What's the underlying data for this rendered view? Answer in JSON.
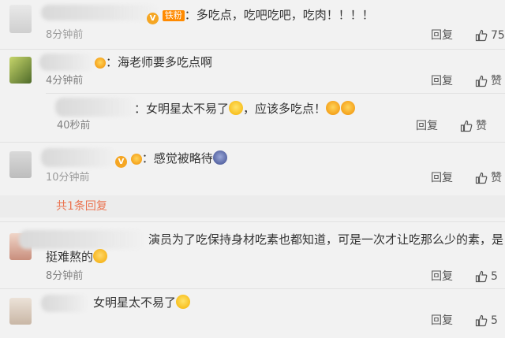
{
  "comments": [
    {
      "text": "：多吃点，吃吧吃吧，吃肉！！！！",
      "badge": "铁粉",
      "time": "8分钟前",
      "reply_label": "回复",
      "likes": "75"
    },
    {
      "text": "：海老师要多吃点啊",
      "time": "4分钟前",
      "reply_label": "回复",
      "like_label": "赞",
      "nested": {
        "text_a": "：女明星太不易了",
        "text_b": "，应该多吃点！",
        "time": "40秒前",
        "reply_label": "回复",
        "like_label": "赞"
      }
    },
    {
      "text": "：感觉被略待",
      "time": "10分钟前",
      "reply_label": "回复",
      "like_label": "赞",
      "reply_count_label": "共1条回复"
    },
    {
      "text_line1": "演员为了吃保持身材吃素也都知道，可是一次才让吃那么少的素，是",
      "text_line2": "挺难熬的",
      "time": "8分钟前",
      "reply_label": "回复",
      "likes": "5"
    },
    {
      "text": "女明星太不易了",
      "reply_label": "回复",
      "likes": "5"
    }
  ],
  "icons": {
    "like": "thumbs-up-icon",
    "verified": "verified-v-icon",
    "emoji_cry": "laugh-cry-emoji",
    "emoji_heart": "heart-eyes-emoji",
    "emoji_sweat": "sweat-smile-emoji",
    "emoji_shock": "shocked-emoji"
  },
  "colors": {
    "background": "#f2f2f2",
    "link": "#eb7350",
    "verified": "#f5a623"
  }
}
